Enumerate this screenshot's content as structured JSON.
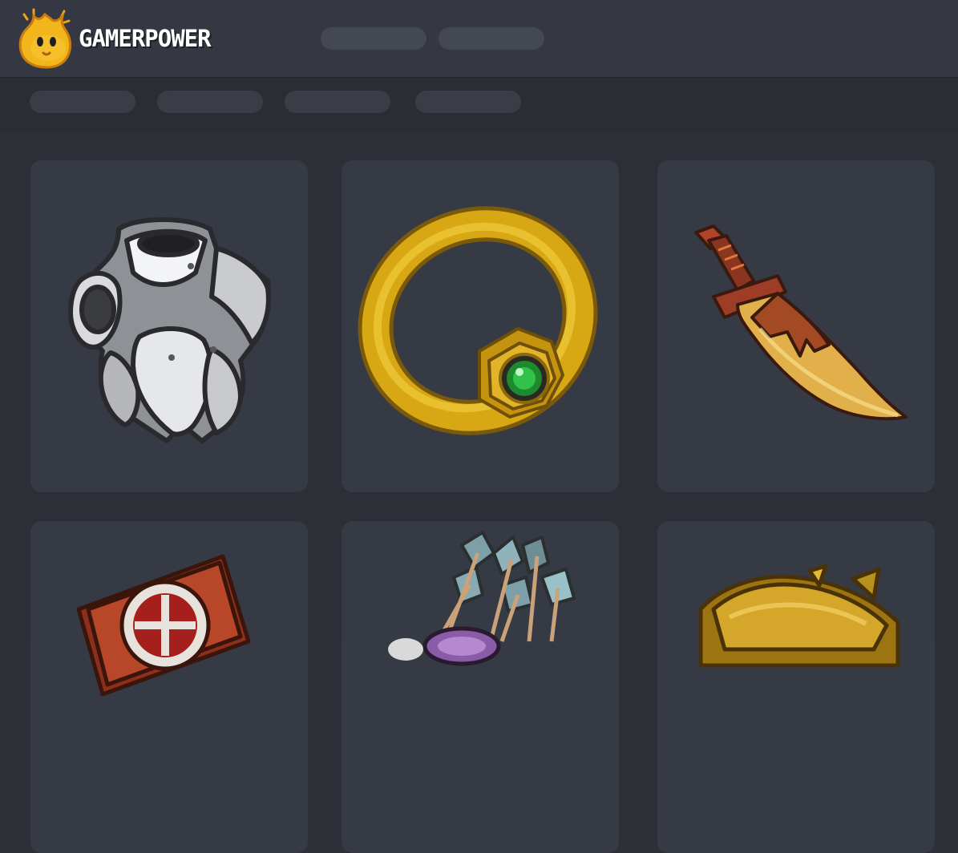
{
  "header": {
    "brand": "GAMERPOWER",
    "logo_icon": "flame-mascot-icon",
    "nav_pills": [
      "",
      ""
    ]
  },
  "filter_bar": {
    "pills": [
      "",
      "",
      "",
      ""
    ]
  },
  "item_grid": {
    "cards": [
      {
        "icon": "chest-armor-icon"
      },
      {
        "icon": "emerald-ring-icon"
      },
      {
        "icon": "curved-dagger-icon"
      },
      {
        "icon": "rune-tome-icon"
      },
      {
        "icon": "arrow-quiver-icon"
      },
      {
        "icon": "golden-helmet-icon"
      }
    ]
  },
  "colors": {
    "header_bg": "#353842",
    "subbar_bg": "#2b2d33",
    "page_bg": "#2d2f36",
    "card_bg": "#363a44",
    "brand_text": "#ffffff",
    "mascot_yellow": "#f3b51c"
  }
}
